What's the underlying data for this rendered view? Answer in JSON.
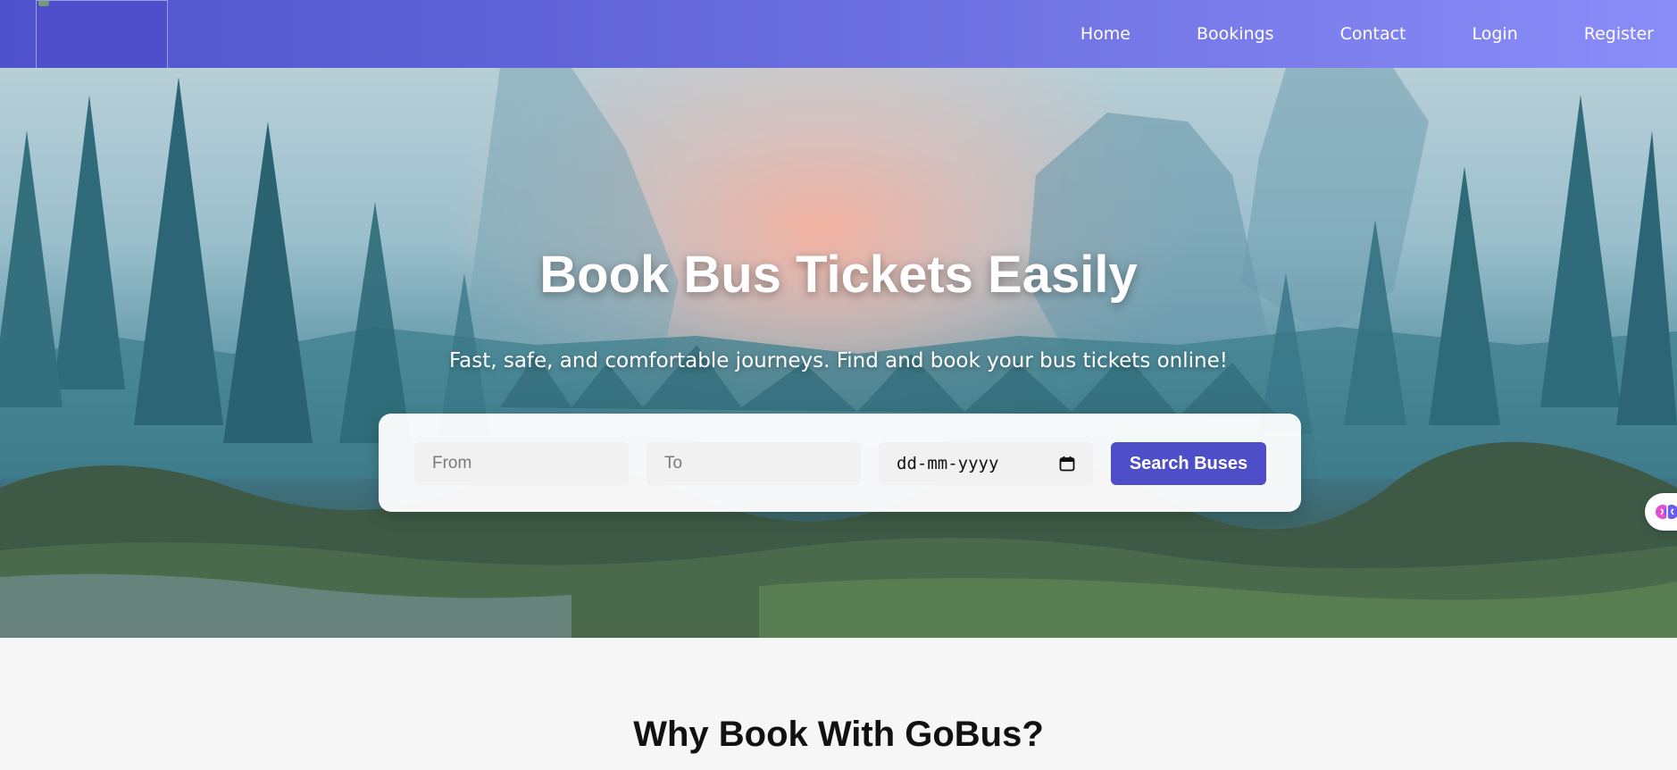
{
  "nav": {
    "items": [
      {
        "label": "Home"
      },
      {
        "label": "Bookings"
      },
      {
        "label": "Contact"
      },
      {
        "label": "Login"
      },
      {
        "label": "Register"
      }
    ]
  },
  "hero": {
    "title": "Book Bus Tickets Easily",
    "subtitle": "Fast, safe, and comfortable journeys. Find and book your bus tickets online!"
  },
  "search": {
    "from_placeholder": "From",
    "to_placeholder": "To",
    "date_placeholder": "dd-mm-yyyy",
    "button_label": "Search Buses"
  },
  "features": {
    "title": "Why Book With GoBus?"
  },
  "colors": {
    "nav_gradient_start": "#5052cc",
    "nav_gradient_end": "#8a8cf8",
    "button": "#4e4ec8"
  },
  "icons": {
    "calendar": "calendar-icon",
    "extension": "brain-extension-icon",
    "logo": "broken-logo-image"
  }
}
